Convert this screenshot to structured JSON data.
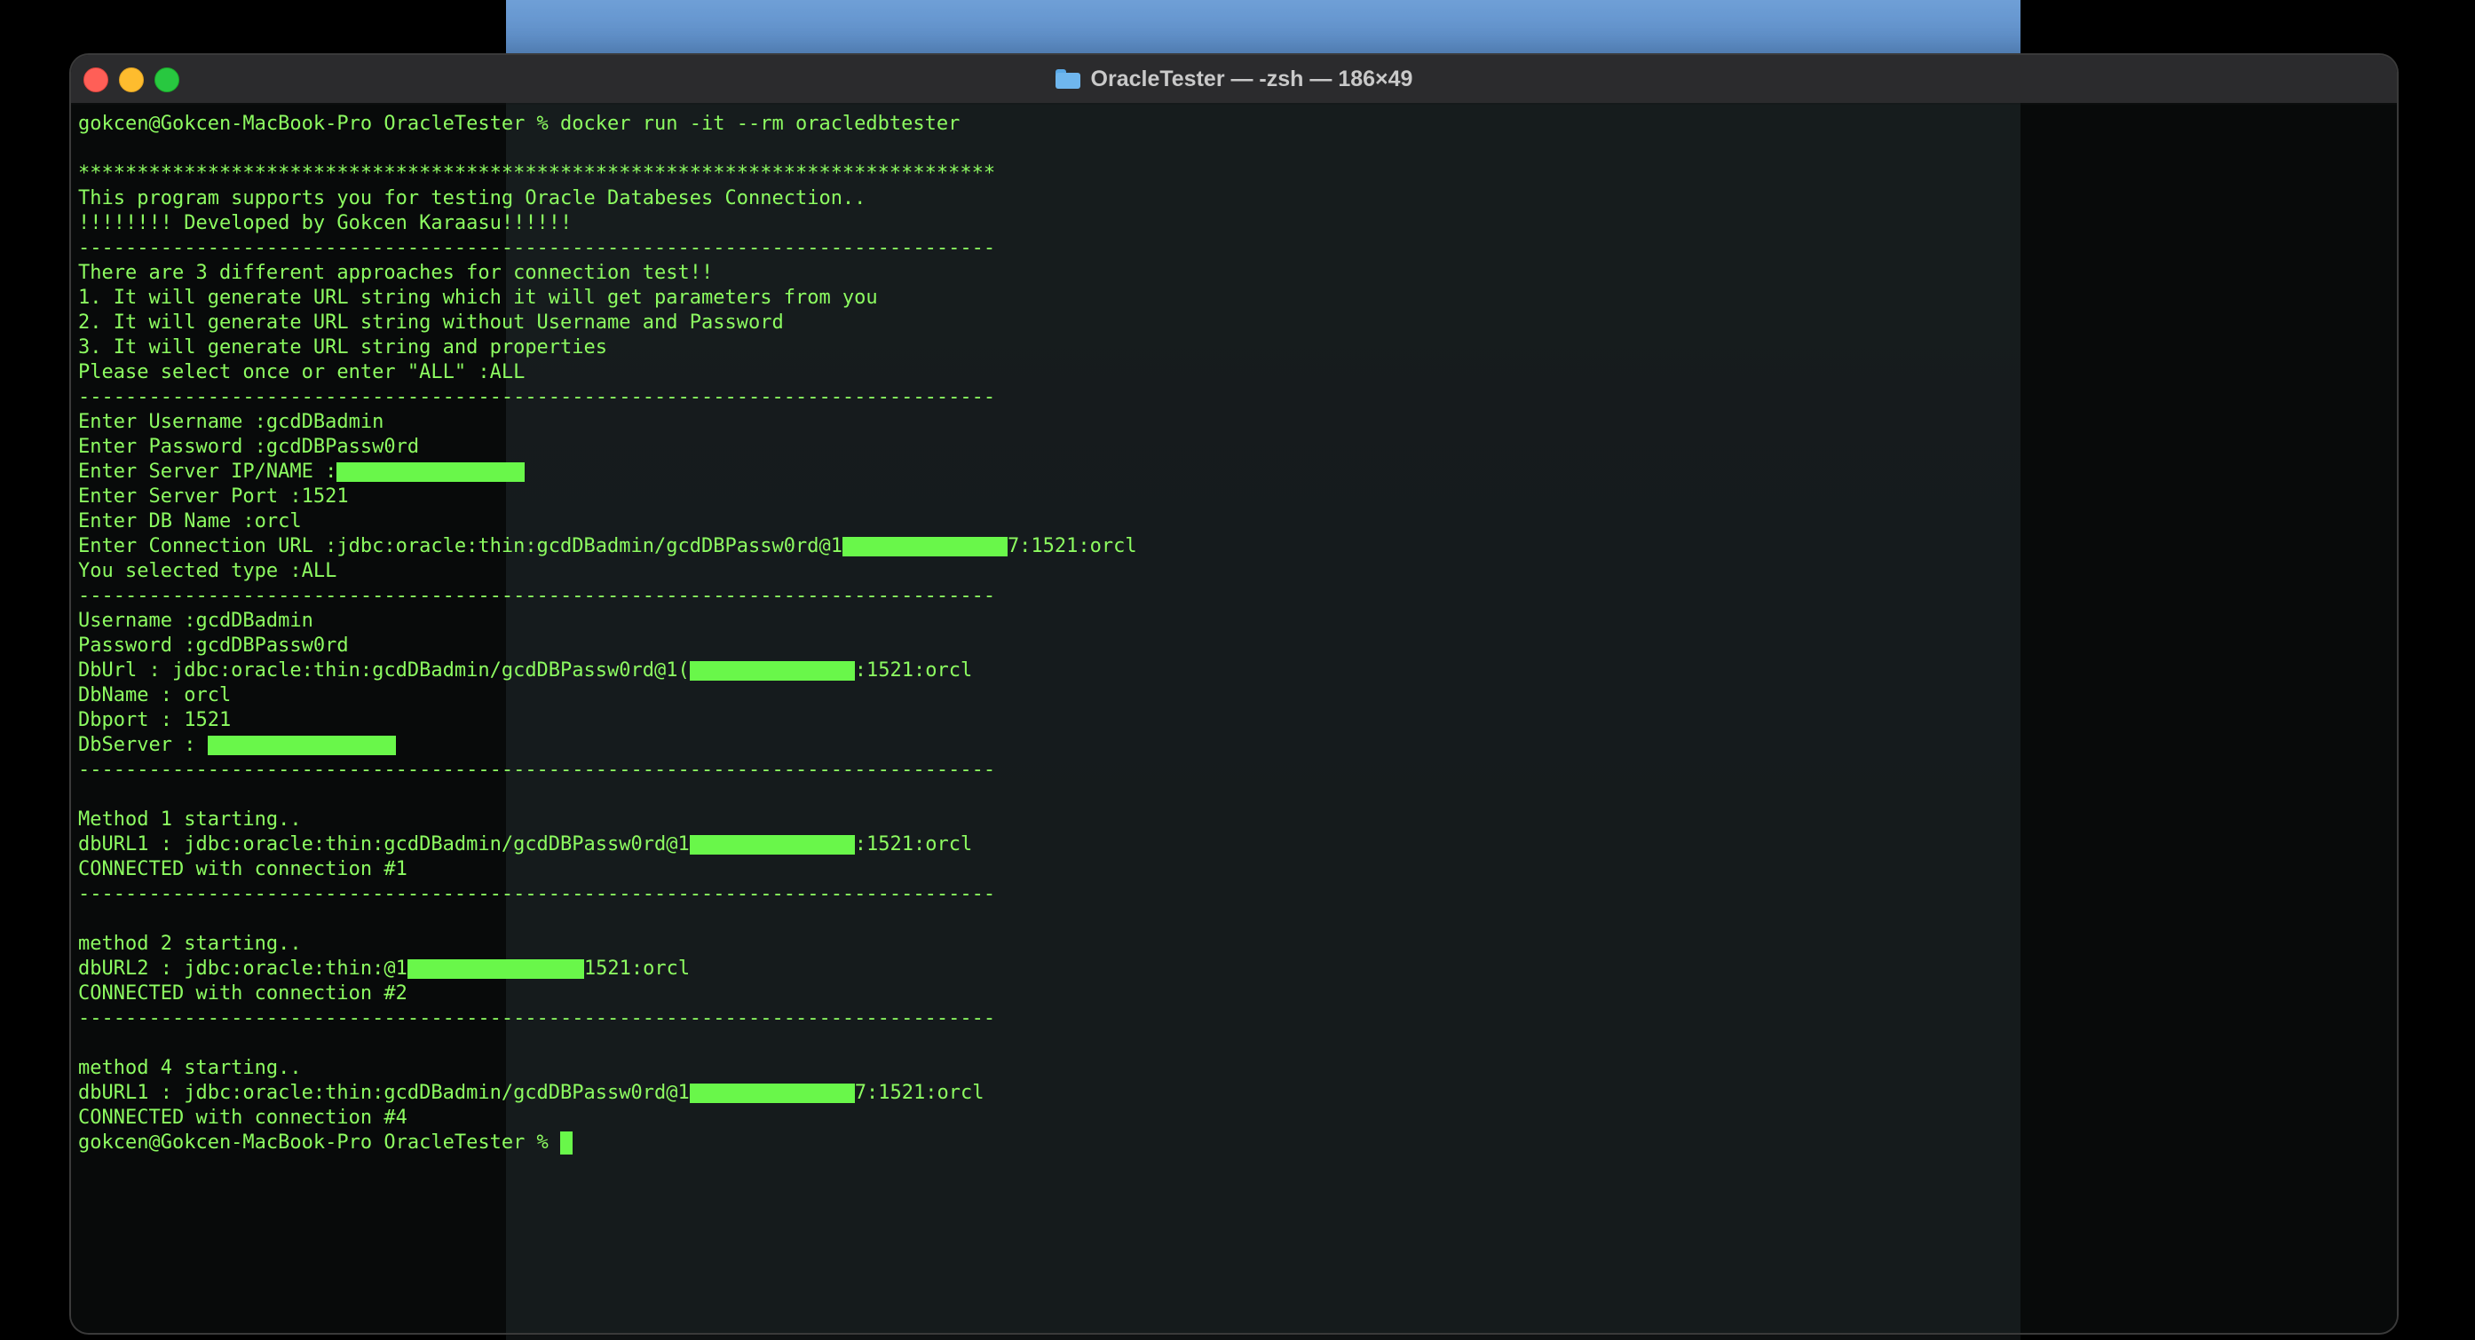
{
  "window": {
    "title": "OracleTester — -zsh — 186×49",
    "folder_icon": "folder-icon",
    "text_color": "#8dfc61",
    "highlight_color": "#69f74a"
  },
  "terminal": {
    "lines": [
      {
        "text": "gokcen@Gokcen-MacBook-Pro OracleTester % docker run -it --rm oracledbtester"
      },
      {
        "text": ""
      },
      {
        "text": "******************************************************************************"
      },
      {
        "text": "This program supports you for testing Oracle Databeses Connection.."
      },
      {
        "text": "!!!!!!!! Developed by Gokcen Karaasu!!!!!!"
      },
      {
        "text": "------------------------------------------------------------------------------"
      },
      {
        "text": "There are 3 different approaches for connection test!!"
      },
      {
        "text": "1. It will generate URL string which it will get parameters from you"
      },
      {
        "text": "2. It will generate URL string without Username and Password"
      },
      {
        "text": "3. It will generate URL string and properties"
      },
      {
        "text": "Please select once or enter \"ALL\" :ALL"
      },
      {
        "text": "------------------------------------------------------------------------------"
      },
      {
        "text": "Enter Username :gcdDBadmin"
      },
      {
        "text": "Enter Password :gcdDBPassw0rd"
      },
      {
        "text": "Enter Server IP/NAME :",
        "redacted": true,
        "redact_chars": 16
      },
      {
        "text": "Enter Server Port :1521"
      },
      {
        "text": "Enter DB Name :orcl"
      },
      {
        "text": "Enter Connection URL :jdbc:oracle:thin:gcdDBadmin/gcdDBPassw0rd@1",
        "redacted": true,
        "redact_chars": 14,
        "suffix": "7:1521:orcl"
      },
      {
        "text": "You selected type :ALL"
      },
      {
        "text": "------------------------------------------------------------------------------"
      },
      {
        "text": "Username :gcdDBadmin"
      },
      {
        "text": "Password :gcdDBPassw0rd"
      },
      {
        "text": "DbUrl : jdbc:oracle:thin:gcdDBadmin/gcdDBPassw0rd@1(",
        "redacted": true,
        "redact_chars": 14,
        "suffix": ":1521:orcl"
      },
      {
        "text": "DbName : orcl"
      },
      {
        "text": "Dbport : 1521"
      },
      {
        "text": "DbServer : ",
        "redacted": true,
        "redact_chars": 16
      },
      {
        "text": "------------------------------------------------------------------------------"
      },
      {
        "text": ""
      },
      {
        "text": "Method 1 starting.."
      },
      {
        "text": "dbURL1 : jdbc:oracle:thin:gcdDBadmin/gcdDBPassw0rd@1",
        "redacted": true,
        "redact_chars": 14,
        "suffix": ":1521:orcl"
      },
      {
        "text": "CONNECTED with connection #1"
      },
      {
        "text": "------------------------------------------------------------------------------"
      },
      {
        "text": ""
      },
      {
        "text": "method 2 starting.."
      },
      {
        "text": "dbURL2 : jdbc:oracle:thin:@1",
        "redacted": true,
        "redact_chars": 15,
        "suffix": "1521:orcl"
      },
      {
        "text": "CONNECTED with connection #2"
      },
      {
        "text": "------------------------------------------------------------------------------"
      },
      {
        "text": ""
      },
      {
        "text": "method 4 starting.."
      },
      {
        "text": "dbURL1 : jdbc:oracle:thin:gcdDBadmin/gcdDBPassw0rd@1",
        "redacted": true,
        "redact_chars": 14,
        "suffix": "7:1521:orcl"
      },
      {
        "text": "CONNECTED with connection #4"
      },
      {
        "text": "gokcen@Gokcen-MacBook-Pro OracleTester % ",
        "cursor": true
      }
    ]
  }
}
